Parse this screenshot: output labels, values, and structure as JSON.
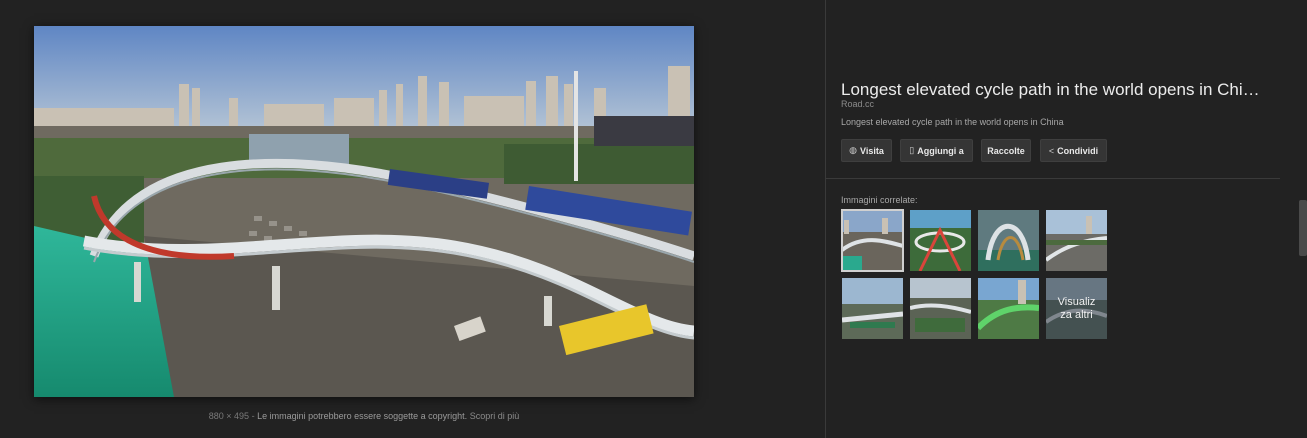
{
  "preview": {
    "dimensions": "880 × 495",
    "separator": " - ",
    "copyright_note": "Le immagini potrebbero essere soggette a copyright.",
    "learn_more": "Scopri di più"
  },
  "details": {
    "title": "Longest elevated cycle path in the world opens in Chi…",
    "source": "Road.cc",
    "description": "Longest elevated cycle path in the world opens in China"
  },
  "actions": [
    {
      "label": "Visita",
      "icon": "globe-icon"
    },
    {
      "label": "Aggiungi a",
      "icon": "bookmark-icon"
    },
    {
      "label": "Raccolte",
      "icon": ""
    },
    {
      "label": "Condividi",
      "icon": "share-icon"
    }
  ],
  "related": {
    "label": "Immagini correlate:",
    "more_label_line1": "Visualiz",
    "more_label_line2": "za altri"
  }
}
